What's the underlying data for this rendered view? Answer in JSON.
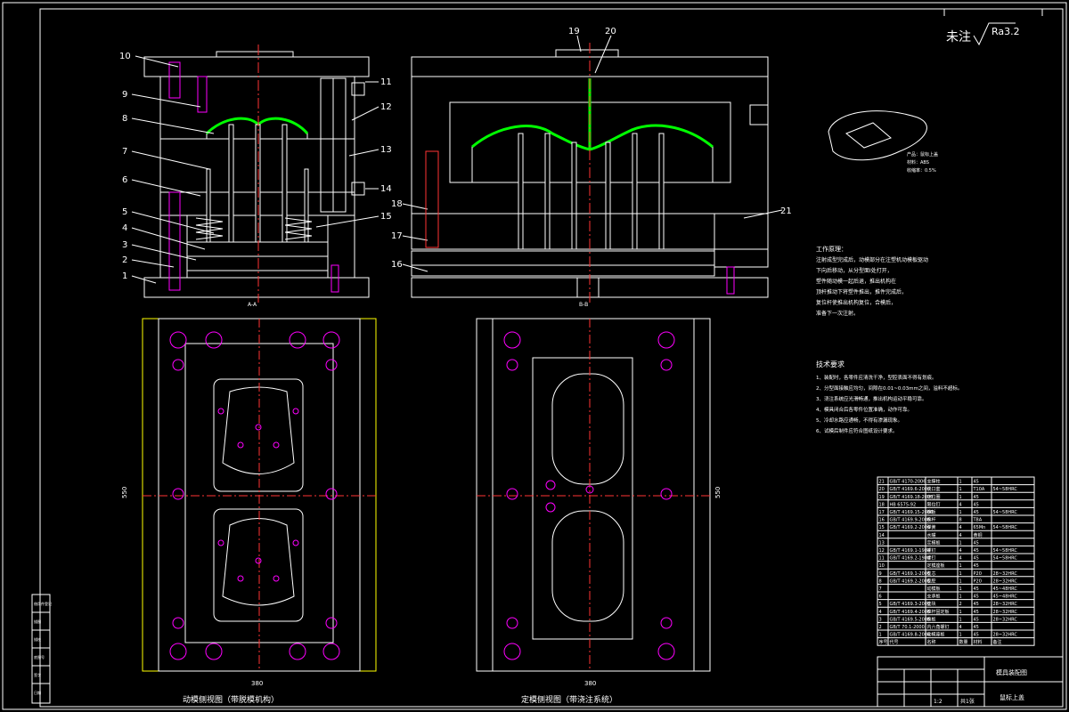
{
  "roughness": {
    "label": "未注",
    "value": "Ra3.2"
  },
  "balloons_left": [
    "10",
    "9",
    "8",
    "7",
    "6",
    "5",
    "4",
    "3",
    "2",
    "1"
  ],
  "balloons_mid_left": [
    "18",
    "17",
    "16"
  ],
  "balloons_right_of_left": [
    "11",
    "12",
    "13",
    "14",
    "15"
  ],
  "balloons_top_right": [
    "19",
    "20"
  ],
  "balloon_21": "21",
  "views": {
    "left_section": "A-A",
    "right_section": "B-B",
    "left_plan_caption": "动模侧视图（带脱模机构）",
    "right_plan_caption": "定模侧视图（带浇注系统）"
  },
  "dims": {
    "left_h": "550",
    "left_w": "380",
    "right_h": "550",
    "right_w": "380"
  },
  "product": {
    "name": "产品：鼠标上盖",
    "material": "材料：ABS",
    "shrink": "收缩率：0.5%"
  },
  "principle": {
    "title": "工作原理：",
    "lines": [
      "注射成型完成后，动模部分在注塑机动模板驱动",
      "下向后移动，从分型面Ⅰ处打开，",
      "塑件随动模一起后退，推出机构在",
      "顶杆推动下将塑件推出，推件完成后，",
      "复位杆使推出机构复位，合模后，",
      "准备下一次注射。"
    ]
  },
  "tech": {
    "title": "技术要求",
    "lines": [
      "1、装配时，各零件应清洗干净，型腔表面不得有划痕。",
      "2、分型面接触应均匀，间隙在0.01~0.03mm之间，溢料不超标。",
      "3、浇注系统应光滑畅通，推出机构运动平稳可靠。",
      "4、模具闭合后各零件位置准确，动作可靠。",
      "5、冷却水路应通畅，不得有渗漏现象。",
      "6、试模后制件应符合图纸设计要求。"
    ]
  },
  "bom": [
    {
      "no": "21",
      "std": "GB/T 4170-2006",
      "name": "支撑柱",
      "qty": "1",
      "mat": "45",
      "note": ""
    },
    {
      "no": "20",
      "std": "GB/T 4169.6-2006",
      "name": "浇口套",
      "qty": "1",
      "mat": "T10A",
      "note": "54~58HRC"
    },
    {
      "no": "19",
      "std": "GB/T 4169.18-2006",
      "name": "定位圈",
      "qty": "1",
      "mat": "45",
      "note": ""
    },
    {
      "no": "18",
      "std": "HB 6575-92",
      "name": "限位钉",
      "qty": "4",
      "mat": "45",
      "note": ""
    },
    {
      "no": "17",
      "std": "GB/T 4169.15-2006",
      "name": "推板",
      "qty": "1",
      "mat": "45",
      "note": "54~58HRC"
    },
    {
      "no": "16",
      "std": "GB/T 4169.9-2006",
      "name": "推杆",
      "qty": "8",
      "mat": "T8A",
      "note": ""
    },
    {
      "no": "15",
      "std": "GB/T 4169.2-2006",
      "name": "弹簧",
      "qty": "4",
      "mat": "65Mn",
      "note": "54~58HRC"
    },
    {
      "no": "14",
      "std": "",
      "name": "水嘴",
      "qty": "4",
      "mat": "黄铜",
      "note": ""
    },
    {
      "no": "13",
      "std": "",
      "name": "定模板",
      "qty": "1",
      "mat": "45",
      "note": ""
    },
    {
      "no": "12",
      "std": "GB/T 4169.1-1984",
      "name": "螺钉",
      "qty": "4",
      "mat": "45",
      "note": "54~58HRC"
    },
    {
      "no": "11",
      "std": "GB/T 4169.2-1984",
      "name": "螺钉",
      "qty": "4",
      "mat": "45",
      "note": "54~58HRC"
    },
    {
      "no": "10",
      "std": "",
      "name": "定模座板",
      "qty": "1",
      "mat": "45",
      "note": ""
    },
    {
      "no": "9",
      "std": "GB/T 4169.1-2006",
      "name": "型芯",
      "qty": "1",
      "mat": "P20",
      "note": "28~32HRC"
    },
    {
      "no": "8",
      "std": "GB/T 4169.2-2006",
      "name": "型腔",
      "qty": "1",
      "mat": "P20",
      "note": "28~32HRC"
    },
    {
      "no": "7",
      "std": "",
      "name": "动模板",
      "qty": "1",
      "mat": "45",
      "note": "45~48HRC"
    },
    {
      "no": "6",
      "std": "",
      "name": "支承板",
      "qty": "1",
      "mat": "45",
      "note": "45~48HRC"
    },
    {
      "no": "5",
      "std": "GB/T 4169.3-2006",
      "name": "垫块",
      "qty": "2",
      "mat": "45",
      "note": "28~32HRC"
    },
    {
      "no": "4",
      "std": "GB/T 4169.4-2006",
      "name": "推杆固定板",
      "qty": "1",
      "mat": "45",
      "note": "28~32HRC"
    },
    {
      "no": "3",
      "std": "GB/T 4169.5-2006",
      "name": "推板",
      "qty": "1",
      "mat": "45",
      "note": "28~32HRC"
    },
    {
      "no": "2",
      "std": "GB/T 70.1-2000",
      "name": "内六角螺钉",
      "qty": "4",
      "mat": "45",
      "note": ""
    },
    {
      "no": "1",
      "std": "GB/T 4169.8-2006",
      "name": "动模座板",
      "qty": "1",
      "mat": "45",
      "note": "28~32HRC"
    }
  ],
  "bom_header": {
    "no": "序号",
    "std": "代号",
    "name": "名称",
    "qty": "数量",
    "mat": "材料",
    "note": "备注"
  },
  "title_block": {
    "drawing_title": "模具装配图",
    "product": "鼠标上盖",
    "scale": "1:2",
    "sheet": "共1张"
  },
  "left_strip": [
    "借用件登记",
    "描图",
    "描校",
    "底图号",
    "签字",
    "日期"
  ],
  "colors": {
    "frame": "#ffffff",
    "hatch": "#ffffff",
    "part": "#00ff00",
    "holes": "#ff00ff",
    "centerline": "#ff3333",
    "dims": "#ffff00"
  }
}
